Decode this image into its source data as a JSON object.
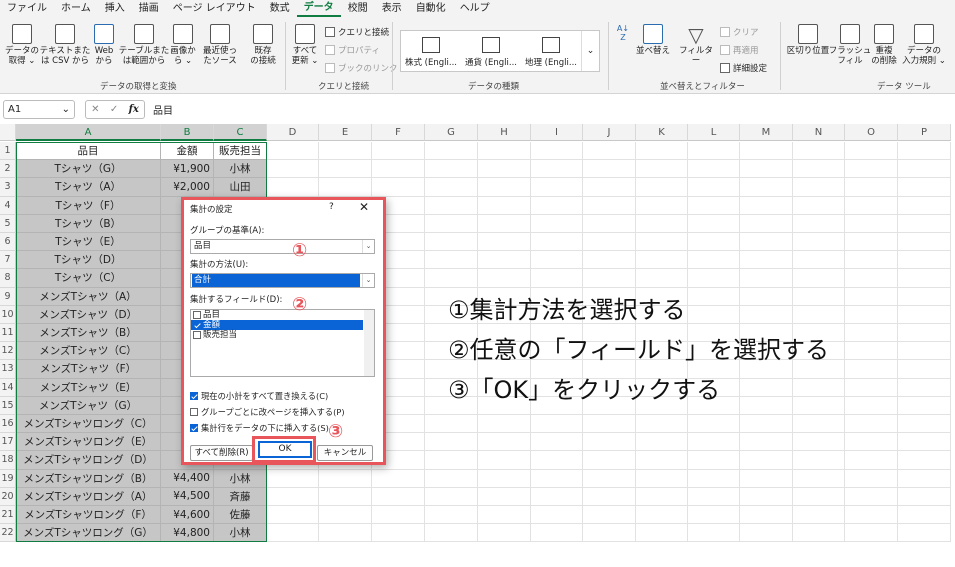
{
  "menu": [
    "ファイル",
    "ホーム",
    "挿入",
    "描画",
    "ページ レイアウト",
    "数式",
    "データ",
    "校閲",
    "表示",
    "自動化",
    "ヘルプ"
  ],
  "menu_active_index": 6,
  "ribbon": {
    "get_transform": [
      {
        "label": "データの\n取得 ⌄"
      },
      {
        "label": "テキストまた\nは CSV から"
      },
      {
        "label": "Web\nから"
      },
      {
        "label": "テーブルまた\nは範囲から"
      },
      {
        "label": "画像か\nら ⌄"
      },
      {
        "label": "最近使っ\nたソース"
      },
      {
        "label": "既存\nの接続"
      }
    ],
    "group_get_transform": "データの取得と変換",
    "refresh_all": "すべて\n更新 ⌄",
    "queries_connections": "クエリと接続",
    "properties": "プロパティ",
    "edit_links": "ブックのリンク",
    "group_queries": "クエリと接続",
    "data_types": [
      "株式 (Engli...",
      "通貨 (Engli...",
      "地理 (Engli..."
    ],
    "group_data_types": "データの種類",
    "sort_label": "並べ替え",
    "filter_label": "フィルター",
    "clear_label": "クリア",
    "reapply_label": "再適用",
    "advanced_label": "詳細設定",
    "group_sort_filter": "並べ替えとフィルター",
    "text_to_columns": "区切り位置",
    "flash_fill": "フラッシュ\nフィル",
    "remove_duplicates": "重複\nの削除",
    "data_validation": "データの\n入力規則 ⌄",
    "group_data_tools": "データ ツール"
  },
  "formula_bar": {
    "name_box": "A1",
    "fx": "fx",
    "value": "品目"
  },
  "columns": [
    "A",
    "B",
    "C",
    "D",
    "E",
    "F",
    "G",
    "H",
    "I",
    "J",
    "K",
    "L",
    "M",
    "N",
    "O",
    "P"
  ],
  "rows": [
    [
      "品目",
      "金額",
      "販売担当"
    ],
    [
      "Tシャツ（G）",
      "¥1,900",
      "小林"
    ],
    [
      "Tシャツ（A）",
      "¥2,000",
      "山田"
    ],
    [
      "Tシャツ（F）",
      "",
      ""
    ],
    [
      "Tシャツ（B）",
      "",
      ""
    ],
    [
      "Tシャツ（E）",
      "",
      ""
    ],
    [
      "Tシャツ（D）",
      "",
      ""
    ],
    [
      "Tシャツ（C）",
      "",
      ""
    ],
    [
      "メンズTシャツ（A）",
      "",
      ""
    ],
    [
      "メンズTシャツ（D）",
      "",
      ""
    ],
    [
      "メンズTシャツ（B）",
      "",
      ""
    ],
    [
      "メンズTシャツ（C）",
      "",
      ""
    ],
    [
      "メンズTシャツ（F）",
      "",
      ""
    ],
    [
      "メンズTシャツ（E）",
      "",
      ""
    ],
    [
      "メンズTシャツ（G）",
      "",
      ""
    ],
    [
      "メンズTシャツロング（C）",
      "",
      ""
    ],
    [
      "メンズTシャツロング（E）",
      "",
      ""
    ],
    [
      "メンズTシャツロング（D）",
      "",
      ""
    ],
    [
      "メンズTシャツロング（B）",
      "¥4,400",
      "小林"
    ],
    [
      "メンズTシャツロング（A）",
      "¥4,500",
      "斉藤"
    ],
    [
      "メンズTシャツロング（F）",
      "¥4,600",
      "佐藤"
    ],
    [
      "メンズTシャツロング（G）",
      "¥4,800",
      "小林"
    ]
  ],
  "dialog": {
    "title": "集計の設定",
    "help": "?",
    "close": "✕",
    "group_by_label": "グループの基準(A):",
    "group_by_value": "品目",
    "function_label": "集計の方法(U):",
    "function_value": "合計",
    "fields_label": "集計するフィールド(D):",
    "fields": [
      {
        "label": "品目",
        "checked": false,
        "selected": false
      },
      {
        "label": "金額",
        "checked": true,
        "selected": true
      },
      {
        "label": "販売担当",
        "checked": false,
        "selected": false
      }
    ],
    "options": [
      {
        "label": "現在の小計をすべて置き換える(C)",
        "checked": true
      },
      {
        "label": "グループごとに改ページを挿入する(P)",
        "checked": false
      },
      {
        "label": "集計行をデータの下に挿入する(S)",
        "checked": true
      }
    ],
    "remove_all": "すべて削除(R)",
    "ok": "OK",
    "cancel": "キャンセル"
  },
  "annotations": {
    "n1": "①",
    "n2": "②",
    "n3": "③"
  },
  "instructions": [
    "①集計方法を選択する",
    "②任意の「フィールド」を選択する",
    "③「OK」をクリックする"
  ],
  "colors": {
    "accent": "#107c41",
    "highlight": "#e8555a",
    "selection": "#0a64d6"
  }
}
